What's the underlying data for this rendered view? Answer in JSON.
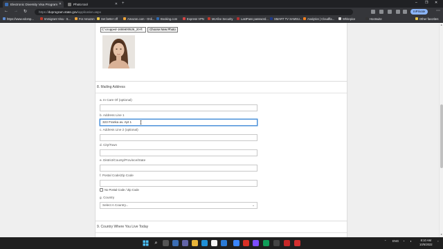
{
  "browser": {
    "tabs": [
      {
        "title": "Electronic Diversity Visa Program",
        "active": true
      },
      {
        "title": "Photo tool",
        "active": false
      }
    ],
    "address": {
      "prefix": "https://",
      "host": "dvprogram.state.gov",
      "path": "/application.aspx"
    },
    "profile_label": "InPrivate",
    "bookmarks": [
      "https://www.edomp...",
      "Immigrant Visa - S...",
      "For Amazon",
      "Set better off",
      "Amazon.com - Onli...",
      "Booking.com",
      "Express VPN",
      "McAfee Security",
      "LastPass password...",
      "SMART TV SAMSU...",
      "Analytics | Cloudfla...",
      "Whitepice",
      "Hootsuite",
      "Other favorites"
    ]
  },
  "photo_section": {
    "file_path": "C:\\cropped-1655600526_20-ft",
    "choose_button": "Choose New Photo"
  },
  "mailing": {
    "heading": "8. Mailing Address",
    "in_care_of_label": "a. In Care Of (optional)",
    "in_care_of_value": "",
    "address1_label": "b. Address Line 1",
    "address1_value": "323 Franka av. Apt 1",
    "address2_label": "c. Address Line 2 (optional)",
    "address2_value": "",
    "city_label": "d. City/Town",
    "city_value": "",
    "district_label": "e. District/County/Province/State",
    "district_value": "",
    "postal_label": "f. Postal Code/Zip Code",
    "postal_value": "",
    "no_postal_label": "No Postal Code / Zip Code",
    "country_label": "g. Country",
    "country_selected": "Select A Country..."
  },
  "next_section": {
    "heading": "9. Country Where You Live Today"
  },
  "taskbar": {
    "tray_lang": "ENG",
    "tray_region": "INTL",
    "time": "8:10 AM",
    "date": "10/5/2022"
  },
  "colors": {
    "accent": "#4a90d9",
    "profile": "#8ab4f8",
    "tab_bar": "#202124"
  }
}
